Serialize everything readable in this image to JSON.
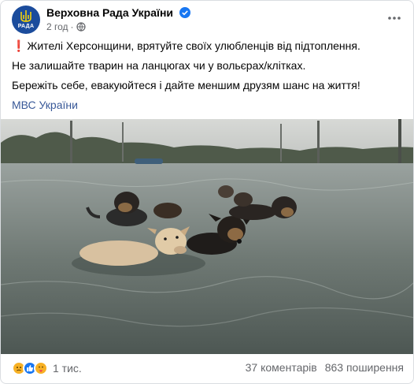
{
  "post": {
    "author": "Верховна Рада України",
    "avatar_text": "РАДА",
    "verified_icon": "verified-badge-icon",
    "time": "2 год",
    "separator": "·",
    "privacy_icon": "globe-icon",
    "more_icon": "more-dots-icon"
  },
  "content": {
    "alert_icon": "❗",
    "line1": "Жителі Херсонщини, врятуйте своїх улюбленців від підтоплення.",
    "line2": "Не залишайте тварин на ланцюгах чи у вольєрах/клітках.",
    "line3": "Бережіть себе, евакуюйтеся і дайте меншим друзям шанс на життя!",
    "link": "МВС України"
  },
  "photo": {
    "subject": "dogs swimming in floodwater"
  },
  "footer": {
    "reactions": [
      "sad",
      "like",
      "care"
    ],
    "reaction_count": "1 тис.",
    "comments": "37 коментарів",
    "shares": "863 поширення"
  },
  "colors": {
    "link": "#385898",
    "secondary_text": "#65676b",
    "verified": "#1877f2",
    "avatar": "#1b4c9c"
  }
}
